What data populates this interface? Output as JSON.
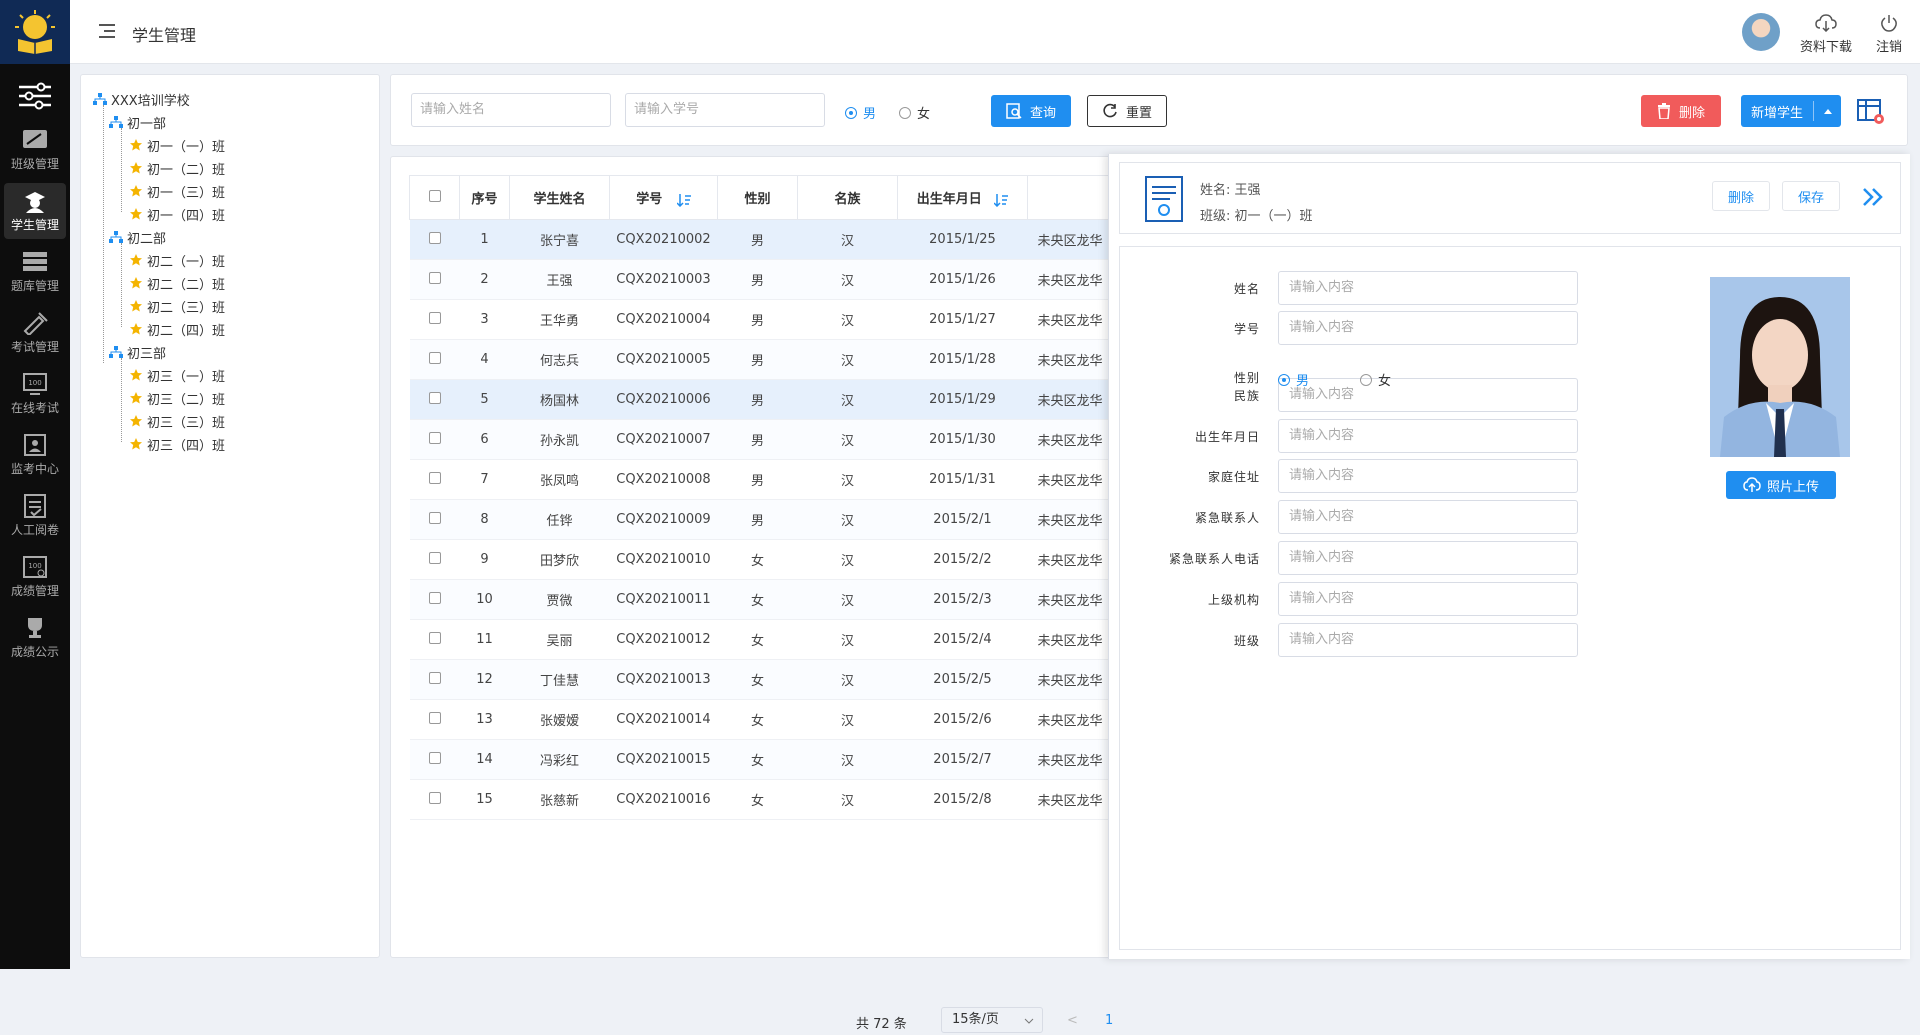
{
  "colors": {
    "primary": "#1f8ef0",
    "danger": "#f15b5b",
    "sidebar": "#0d0d0d",
    "selected_row": "#e6f0fc"
  },
  "header": {
    "title": "学生管理",
    "download_label": "资料下载",
    "logout_label": "注销"
  },
  "sidebar": {
    "items": [
      {
        "label": "班级管理",
        "icon": "class-icon"
      },
      {
        "label": "学生管理",
        "icon": "student-icon",
        "active": true
      },
      {
        "label": "题库管理",
        "icon": "question-bank-icon"
      },
      {
        "label": "考试管理",
        "icon": "exam-icon"
      },
      {
        "label": "在线考试",
        "icon": "online-exam-icon"
      },
      {
        "label": "监考中心",
        "icon": "proctor-icon"
      },
      {
        "label": "人工阅卷",
        "icon": "grading-icon"
      },
      {
        "label": "成绩管理",
        "icon": "score-icon"
      },
      {
        "label": "成绩公示",
        "icon": "trophy-icon"
      }
    ]
  },
  "tree": {
    "root": "XXX培训学校",
    "groups": [
      {
        "label": "初一部",
        "classes": [
          "初一（一）班",
          "初一（二）班",
          "初一（三）班",
          "初一（四）班"
        ]
      },
      {
        "label": "初二部",
        "classes": [
          "初二（一）班",
          "初二（二）班",
          "初二（三）班",
          "初二（四）班"
        ]
      },
      {
        "label": "初三部",
        "classes": [
          "初三（一）班",
          "初三（二）班",
          "初三（三）班",
          "初三（四）班"
        ]
      }
    ]
  },
  "search": {
    "name_placeholder": "请输入姓名",
    "id_placeholder": "请输入学号",
    "gender_male": "男",
    "gender_female": "女",
    "query_label": "查询",
    "reset_label": "重置",
    "delete_label": "删除",
    "add_label": "新增学生"
  },
  "table": {
    "headers": [
      "序号",
      "学生姓名",
      "学号",
      "性别",
      "名族",
      "出生年月日"
    ],
    "rows": [
      [
        "1",
        "张宁喜",
        "CQX20210002",
        "男",
        "汉",
        "2015/1/25",
        "未央区龙华"
      ],
      [
        "2",
        "王强",
        "CQX20210003",
        "男",
        "汉",
        "2015/1/26",
        "未央区龙华"
      ],
      [
        "3",
        "王华勇",
        "CQX20210004",
        "男",
        "汉",
        "2015/1/27",
        "未央区龙华"
      ],
      [
        "4",
        "何志兵",
        "CQX20210005",
        "男",
        "汉",
        "2015/1/28",
        "未央区龙华"
      ],
      [
        "5",
        "杨国林",
        "CQX20210006",
        "男",
        "汉",
        "2015/1/29",
        "未央区龙华"
      ],
      [
        "6",
        "孙永凯",
        "CQX20210007",
        "男",
        "汉",
        "2015/1/30",
        "未央区龙华"
      ],
      [
        "7",
        "张凤鸣",
        "CQX20210008",
        "男",
        "汉",
        "2015/1/31",
        "未央区龙华"
      ],
      [
        "8",
        "任铧",
        "CQX20210009",
        "男",
        "汉",
        "2015/2/1",
        "未央区龙华"
      ],
      [
        "9",
        "田梦欣",
        "CQX20210010",
        "女",
        "汉",
        "2015/2/2",
        "未央区龙华"
      ],
      [
        "10",
        "贾微",
        "CQX20210011",
        "女",
        "汉",
        "2015/2/3",
        "未央区龙华"
      ],
      [
        "11",
        "吴丽",
        "CQX20210012",
        "女",
        "汉",
        "2015/2/4",
        "未央区龙华"
      ],
      [
        "12",
        "丁佳慧",
        "CQX20210013",
        "女",
        "汉",
        "2015/2/5",
        "未央区龙华"
      ],
      [
        "13",
        "张嫒嫒",
        "CQX20210014",
        "女",
        "汉",
        "2015/2/6",
        "未央区龙华"
      ],
      [
        "14",
        "冯彩红",
        "CQX20210015",
        "女",
        "汉",
        "2015/2/7",
        "未央区龙华"
      ],
      [
        "15",
        "张慈新",
        "CQX20210016",
        "女",
        "汉",
        "2015/2/8",
        "未央区龙华"
      ]
    ],
    "selected_rows": [
      1,
      5
    ]
  },
  "pager": {
    "total": "共 72 条",
    "page_size": "15条/页",
    "prev": "<",
    "current": "1"
  },
  "detail": {
    "name_line": "姓名: 王强",
    "class_line": "班级: 初一（一）班",
    "delete_label": "删除",
    "save_label": "保存",
    "upload_label": "照片上传",
    "fields": [
      {
        "label": "姓名",
        "placeholder": "请输入内容"
      },
      {
        "label": "学号",
        "placeholder": "请输入内容"
      },
      {
        "label": "民族",
        "placeholder": "请输入内容"
      },
      {
        "label": "出生年月日",
        "placeholder": "请输入内容"
      },
      {
        "label": "家庭住址",
        "placeholder": "请输入内容"
      },
      {
        "label": "紧急联系人",
        "placeholder": "请输入内容"
      },
      {
        "label": "紧急联系人电话",
        "placeholder": "请输入内容"
      },
      {
        "label": "上级机构",
        "placeholder": "请输入内容"
      },
      {
        "label": "班级",
        "placeholder": "请输入内容"
      }
    ],
    "gender_label": "性别",
    "gender_male": "男",
    "gender_female": "女"
  }
}
